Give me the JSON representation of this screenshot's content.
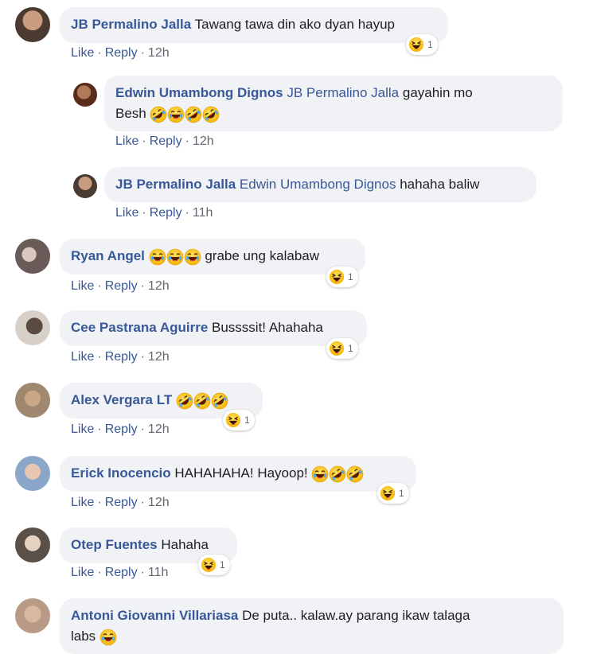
{
  "actions": {
    "like": "Like",
    "reply": "Reply",
    "separator": "·"
  },
  "colors": {
    "name": "#385898",
    "bubble": "#f0f2f5",
    "text": "#1c1e21",
    "meta": "#606770"
  },
  "comments": [
    {
      "name": "JB Permalino Jalla",
      "text": "Tawang tawa din ako dyan hayup",
      "time": "12h",
      "reaction_count": "1"
    },
    {
      "name": "Edwin Umambong Dignos",
      "mention": "JB Permalino Jalla",
      "text": "gayahin mo",
      "text2": "Besh",
      "time": "12h"
    },
    {
      "name": "JB Permalino Jalla",
      "mention": "Edwin Umambong Dignos",
      "text": "hahaha baliw",
      "time": "11h"
    },
    {
      "name": "Ryan Angel",
      "text": "grabe ung kalabaw",
      "time": "12h",
      "reaction_count": "1"
    },
    {
      "name": "Cee Pastrana Aguirre",
      "text": "Bussssit! Ahahaha",
      "time": "12h",
      "reaction_count": "1"
    },
    {
      "name": "Alex Vergara LT",
      "text": "",
      "time": "12h",
      "reaction_count": "1"
    },
    {
      "name": "Erick Inocencio",
      "text": "HAHAHAHA! Hayoop!",
      "time": "12h",
      "reaction_count": "1"
    },
    {
      "name": "Otep Fuentes",
      "text": "Hahaha",
      "time": "11h",
      "reaction_count": "1"
    },
    {
      "name": "Antoni Giovanni Villariasa",
      "text": "De puta.. kalaw.ay parang ikaw talaga",
      "text2": "labs"
    }
  ],
  "icons": {
    "laugh": "laughing-face-icon",
    "rofl": "rolling-on-floor-laughing-icon",
    "haha_reaction": "haha-reaction-icon"
  }
}
